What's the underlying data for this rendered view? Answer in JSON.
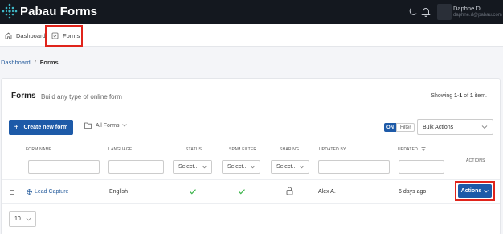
{
  "app": {
    "title": "Pabau Forms"
  },
  "user": {
    "name": "Daphne D.",
    "email": "daphne.d@pabau.com"
  },
  "nav": {
    "dashboard": "Dashboard",
    "forms": "Forms"
  },
  "breadcrumb": {
    "parent": "Dashboard",
    "separator": "/",
    "current": "Forms"
  },
  "header": {
    "title": "Forms",
    "subtitle": "Build any type of online form",
    "showing_prefix": "Showing ",
    "showing_range": "1-1",
    "showing_of": " of ",
    "showing_total": "1",
    "showing_suffix": " item."
  },
  "toolbar": {
    "create_label": "Create new form",
    "create_icon": "+",
    "folder_label": "All Forms",
    "toggle_on": "ON",
    "toggle_filter": "Filter",
    "bulk_label": "Bulk Actions"
  },
  "table": {
    "columns": [
      "FORM NAME",
      "LANGUAGE",
      "STATUS",
      "SPAM FILTER",
      "SHARING",
      "UPDATED BY",
      "UPDATED",
      "ACTIONS"
    ],
    "select_placeholder": "Select...",
    "rows": [
      {
        "form_name": "Lead Capture",
        "language": "English",
        "status": "check",
        "spam_filter": "check",
        "sharing": "lock",
        "updated_by": "Alex A.",
        "updated": "6 days ago",
        "action_label": "Actions"
      }
    ]
  },
  "pagination": {
    "page_size": "10"
  },
  "colors": {
    "primary": "#1d5aa8",
    "topbar": "#14181f",
    "highlight": "#e0241b",
    "success": "#3cb44b",
    "link": "#2a5f9e"
  }
}
